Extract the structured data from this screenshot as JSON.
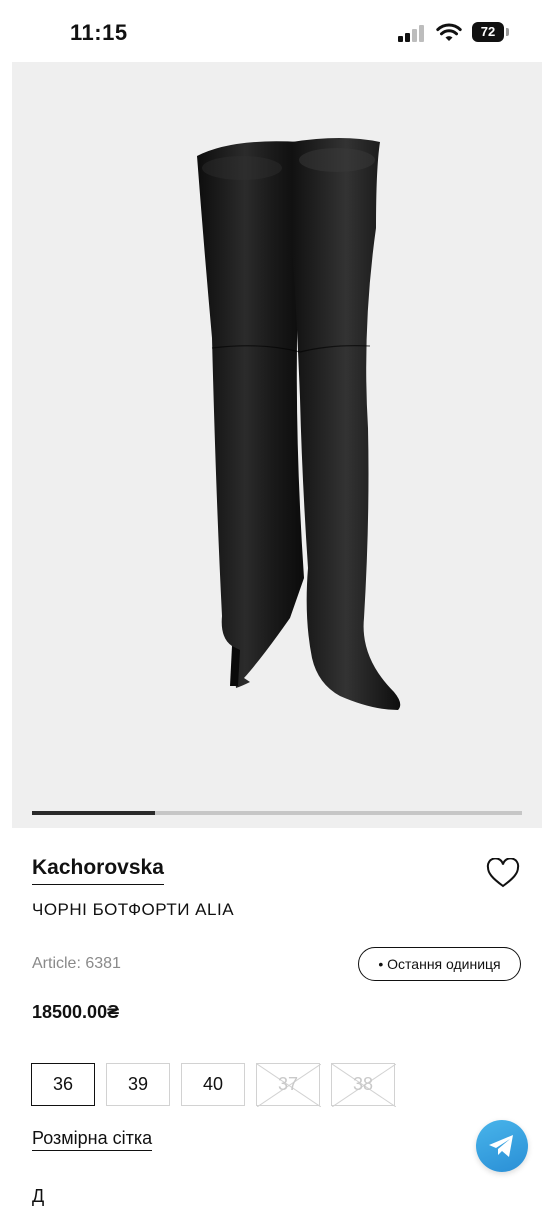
{
  "status_bar": {
    "time": "11:15",
    "battery": "72"
  },
  "gallery": {
    "image_name": "black-over-the-knee-boots",
    "current_slide_fraction": 0.25
  },
  "product": {
    "brand": "Kachorovska",
    "title": "ЧОРНІ БОТФОРТИ ALIA",
    "article": "Article: 6381",
    "badge": "• Остання одиниця",
    "price": "18500.00₴"
  },
  "sizes": [
    {
      "label": "36",
      "state": "selected"
    },
    {
      "label": "39",
      "state": "available"
    },
    {
      "label": "40",
      "state": "available"
    },
    {
      "label": "37",
      "state": "unavailable"
    },
    {
      "label": "38",
      "state": "unavailable"
    }
  ],
  "size_chart_link": "Розмірна сітка",
  "next_section_partial": "Д",
  "colors": {
    "accent_telegram": "#2a9fe0",
    "gallery_bg": "#efefef",
    "text": "#111111",
    "muted": "#8a8a8a"
  },
  "icons": [
    "heart-icon",
    "telegram-icon",
    "signal-icon",
    "wifi-icon",
    "battery-icon"
  ]
}
